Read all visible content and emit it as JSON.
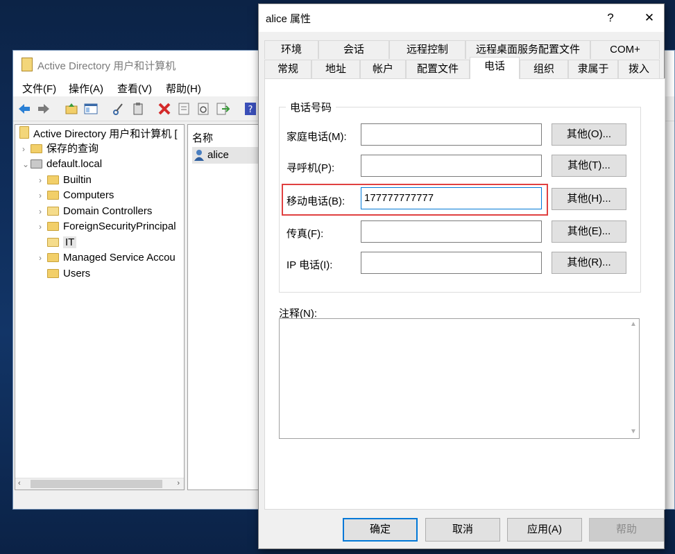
{
  "ad_window": {
    "title": "Active Directory 用户和计算机",
    "menu": [
      "文件(F)",
      "操作(A)",
      "查看(V)",
      "帮助(H)"
    ],
    "tree": {
      "root": "Active Directory 用户和计算机 [",
      "items": [
        "保存的查询",
        "default.local",
        "Builtin",
        "Computers",
        "Domain Controllers",
        "ForeignSecurityPrincipal",
        "IT",
        "Managed Service Accou",
        "Users"
      ]
    },
    "list": {
      "column_header": "名称",
      "items": [
        "alice"
      ]
    }
  },
  "dialog": {
    "title": "alice 属性",
    "help_glyph": "?",
    "close_glyph": "✕",
    "tabs_row1": [
      "环境",
      "会话",
      "远程控制",
      "远程桌面服务配置文件",
      "COM+"
    ],
    "tabs_row2": [
      "常规",
      "地址",
      "帐户",
      "配置文件",
      "电话",
      "组织",
      "隶属于",
      "拨入"
    ],
    "active_tab": "电话",
    "group_title": "电话号码",
    "fields": [
      {
        "label": "家庭电话(M):",
        "value": "",
        "button": "其他(O)..."
      },
      {
        "label": "寻呼机(P):",
        "value": "",
        "button": "其他(T)..."
      },
      {
        "label": "移动电话(B):",
        "value": "177777777777",
        "button": "其他(H)..."
      },
      {
        "label": "传真(F):",
        "value": "",
        "button": "其他(E)..."
      },
      {
        "label": "IP 电话(I):",
        "value": "",
        "button": "其他(R)..."
      }
    ],
    "notes_label": "注释(N):",
    "notes_value": "",
    "buttons": {
      "ok": "确定",
      "cancel": "取消",
      "apply": "应用(A)",
      "help": "帮助"
    }
  },
  "colors": {
    "highlight": "#e04040",
    "accent": "#0078d7"
  }
}
